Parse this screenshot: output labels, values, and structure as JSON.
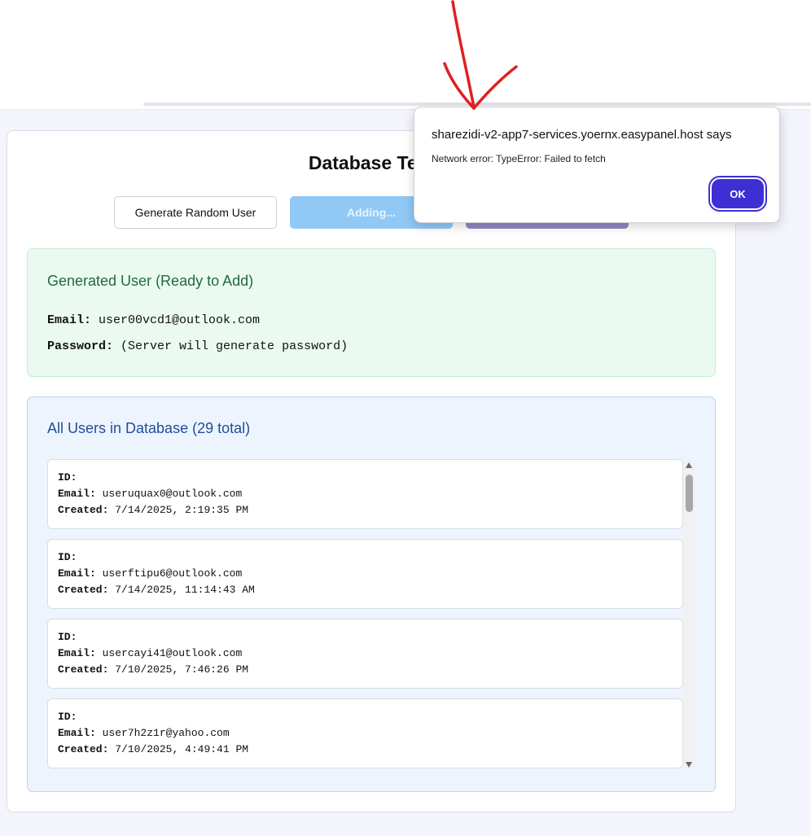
{
  "page": {
    "title": "Database Test"
  },
  "toolbar": {
    "generate_label": "Generate Random User",
    "adding_label": "Adding...",
    "third_label": ""
  },
  "generated_user": {
    "heading": "Generated User (Ready to Add)",
    "email_label": "Email:",
    "email_value": "user00vcd1@outlook.com",
    "password_label": "Password:",
    "password_value": "(Server will generate password)"
  },
  "users_panel": {
    "heading": "All Users in Database (29 total)",
    "id_label": "ID:",
    "email_label": "Email:",
    "created_label": "Created:",
    "users": [
      {
        "id": "",
        "email": "useruquax0@outlook.com",
        "created": "7/14/2025, 2:19:35 PM"
      },
      {
        "id": "",
        "email": "userftipu6@outlook.com",
        "created": "7/14/2025, 11:14:43 AM"
      },
      {
        "id": "",
        "email": "usercayi41@outlook.com",
        "created": "7/10/2025, 7:46:26 PM"
      },
      {
        "id": "",
        "email": "user7h2z1r@yahoo.com",
        "created": "7/10/2025, 4:49:41 PM"
      }
    ]
  },
  "dialog": {
    "title": "sharezidi-v2-app7-services.yoernx.easypanel.host says",
    "message": "Network error: TypeError: Failed to fetch",
    "ok_label": "OK"
  },
  "colors": {
    "adding_button": "#90c8f6",
    "ok_button": "#3d2fd3",
    "green_panel": "#ebfaf1",
    "blue_panel": "#edf4fd",
    "annotation_arrow": "#e02020"
  }
}
